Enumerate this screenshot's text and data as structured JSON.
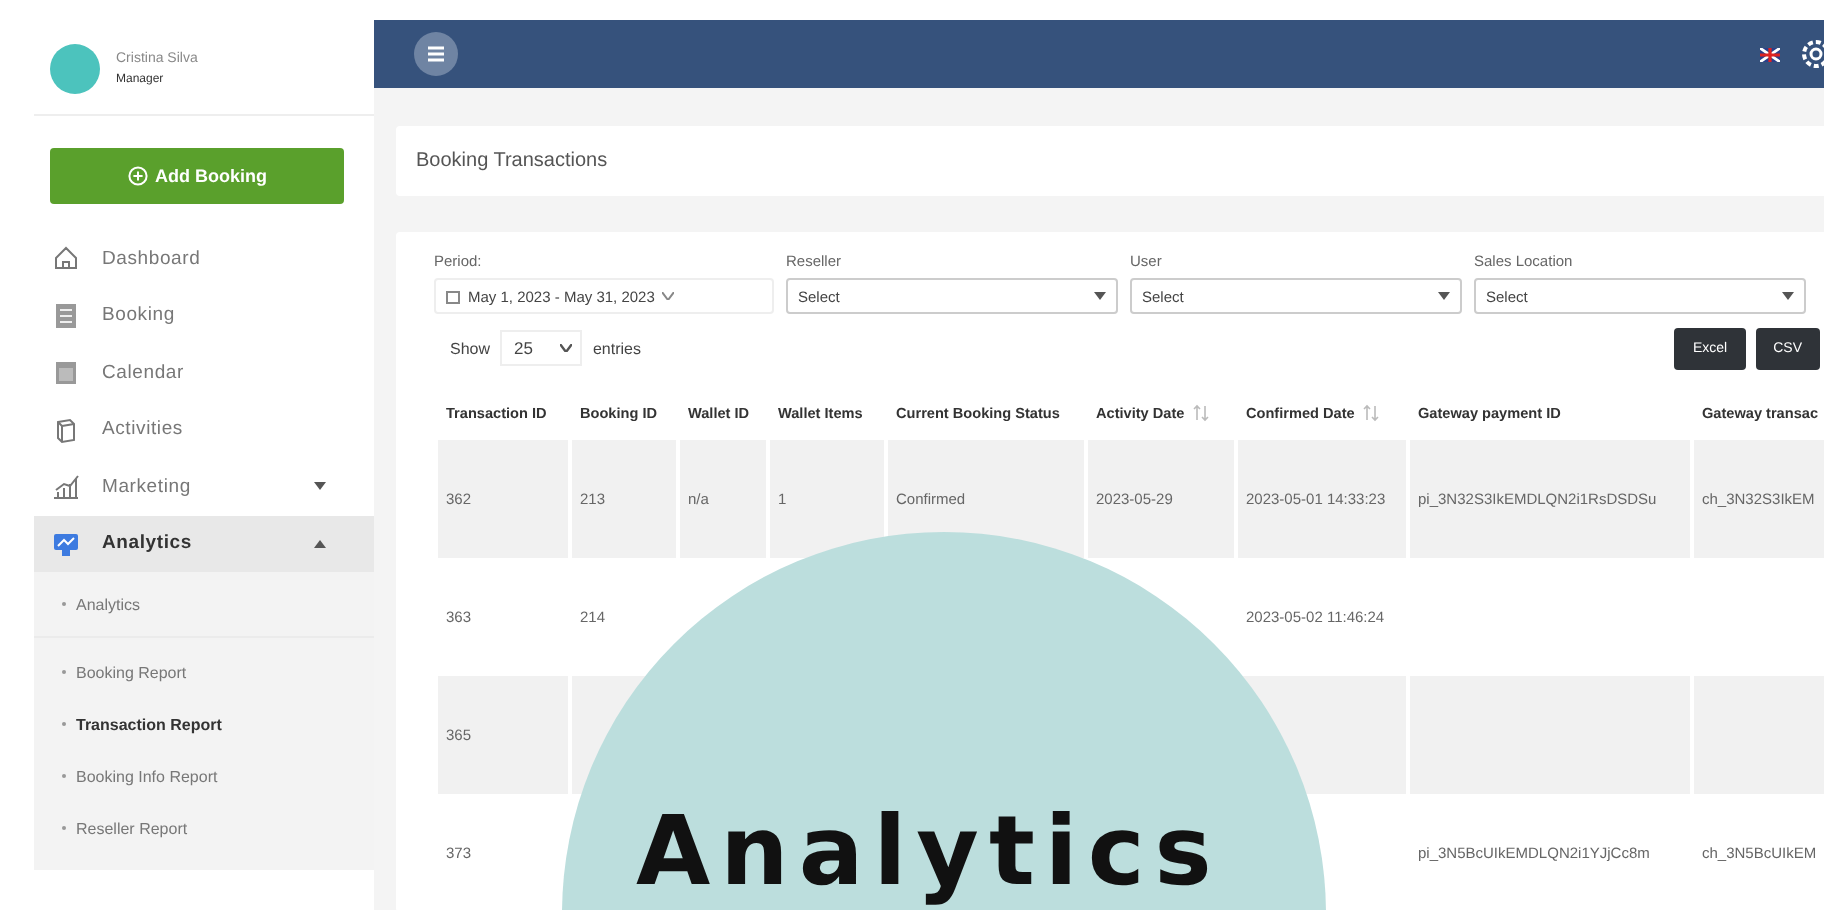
{
  "user": {
    "name": "Cristina Silva",
    "role": "Manager"
  },
  "add_button": {
    "label": "Add Booking"
  },
  "sidebar": {
    "items": [
      {
        "label": "Dashboard",
        "selected": false
      },
      {
        "label": "Booking",
        "selected": false
      },
      {
        "label": "Calendar",
        "selected": false
      },
      {
        "label": "Activities",
        "selected": false
      },
      {
        "label": "Marketing",
        "selected": false,
        "expanded": false
      },
      {
        "label": "Analytics",
        "selected": true,
        "expanded": true,
        "children": [
          {
            "label": "Analytics",
            "selected": false
          },
          {
            "label": "Booking Report",
            "selected": false
          },
          {
            "label": "Transaction Report",
            "selected": true
          },
          {
            "label": "Booking Info Report",
            "selected": false
          },
          {
            "label": "Reseller Report",
            "selected": false
          }
        ]
      }
    ]
  },
  "page_title": "Booking Transactions",
  "filters": [
    {
      "kind": "date",
      "label": "Period:",
      "value": "May 1, 2023 - May 31, 2023"
    },
    {
      "kind": "select",
      "label": "Reseller",
      "value": "Select"
    },
    {
      "kind": "select",
      "label": "User",
      "value": "Select"
    },
    {
      "kind": "select",
      "label": "Sales Location",
      "value": "Select"
    }
  ],
  "entries": {
    "before": "Show",
    "value": "25",
    "after": "entries"
  },
  "export_buttons": [
    "Excel",
    "CSV"
  ],
  "table": {
    "columns": [
      {
        "label": "Transaction ID",
        "sortable": false
      },
      {
        "label": "Booking ID",
        "sortable": false
      },
      {
        "label": "Wallet ID",
        "sortable": false
      },
      {
        "label": "Wallet Items",
        "sortable": false
      },
      {
        "label": "Current Booking Status",
        "sortable": false
      },
      {
        "label": "Activity Date",
        "sortable": true
      },
      {
        "label": "Confirmed Date",
        "sortable": true
      },
      {
        "label": "Gateway payment ID",
        "sortable": false
      },
      {
        "label": "Gateway transac"
      }
    ],
    "rows": [
      {
        "transaction_id": "362",
        "booking_id": "213",
        "wallet_id": "n/a",
        "wallet_items": "1",
        "status": "Confirmed",
        "activity_date": "2023-05-29",
        "confirmed_date": "2023-05-01 14:33:23",
        "gateway_payment_id": "pi_3N32S3IkEMDLQN2i1RsDSDSu",
        "gateway_transaction": "ch_3N32S3IkEM"
      },
      {
        "transaction_id": "363",
        "booking_id": "214",
        "confirmed_date": "2023-05-02 11:46:24"
      },
      {
        "transaction_id": "365"
      },
      {
        "transaction_id": "373",
        "gateway_payment_id": "pi_3N5BcUIkEMDLQN2i1YJjCc8m",
        "gateway_transaction": "ch_3N5BcUIkEM"
      }
    ]
  },
  "overlay": {
    "title": "Analytics"
  }
}
